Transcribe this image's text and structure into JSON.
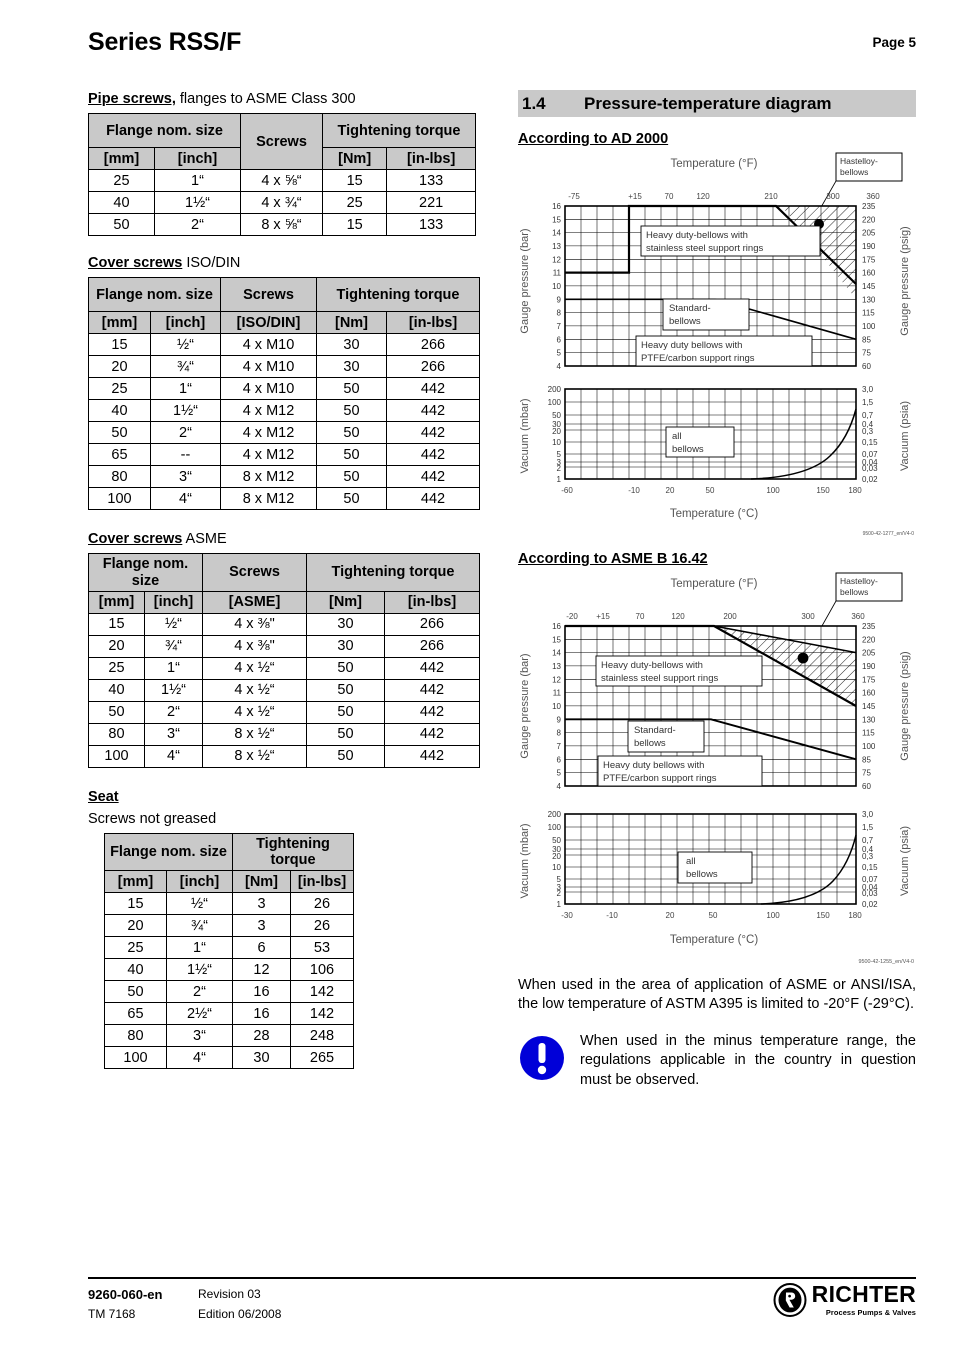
{
  "header": {
    "title": "Series RSS/F",
    "page_label": "Page 5"
  },
  "pipe_screws": {
    "caption_bold": "Pipe screws,",
    "caption_rest": " flanges to ASME Class 300",
    "headers": {
      "flange": "Flange nom. size",
      "screws": "Screws",
      "torque": "Tightening torque",
      "mm": "[mm]",
      "inch": "[inch]",
      "std": "[ASME]",
      "nm": "[Nm]",
      "inlbs": "[in-lbs]"
    },
    "rows": [
      {
        "mm": "25",
        "inch": "1“",
        "screws": "4 x ⅝“",
        "nm": "15",
        "inlbs": "133"
      },
      {
        "mm": "40",
        "inch": "1½“",
        "screws": "4 x ¾“",
        "nm": "25",
        "inlbs": "221"
      },
      {
        "mm": "50",
        "inch": "2“",
        "screws": "8 x ⅝“",
        "nm": "15",
        "inlbs": "133"
      }
    ]
  },
  "cover_screws_iso": {
    "caption_bold": "Cover screws",
    "caption_rest": " ISO/DIN",
    "headers": {
      "flange": "Flange nom. size",
      "screws": "Screws",
      "torque": "Tightening torque",
      "mm": "[mm]",
      "inch": "[inch]",
      "std": "[ISO/DIN]",
      "nm": "[Nm]",
      "inlbs": "[in-lbs]"
    },
    "rows": [
      {
        "mm": "15",
        "inch": "½“",
        "screws": "4 x M10",
        "nm": "30",
        "inlbs": "266"
      },
      {
        "mm": "20",
        "inch": "¾“",
        "screws": "4 x M10",
        "nm": "30",
        "inlbs": "266"
      },
      {
        "mm": "25",
        "inch": "1“",
        "screws": "4 x M10",
        "nm": "50",
        "inlbs": "442"
      },
      {
        "mm": "40",
        "inch": "1½“",
        "screws": "4 x M12",
        "nm": "50",
        "inlbs": "442"
      },
      {
        "mm": "50",
        "inch": "2“",
        "screws": "4 x M12",
        "nm": "50",
        "inlbs": "442"
      },
      {
        "mm": "65",
        "inch": "--",
        "screws": "4 x M12",
        "nm": "50",
        "inlbs": "442"
      },
      {
        "mm": "80",
        "inch": "3“",
        "screws": "8 x M12",
        "nm": "50",
        "inlbs": "442"
      },
      {
        "mm": "100",
        "inch": "4“",
        "screws": "8 x M12",
        "nm": "50",
        "inlbs": "442"
      }
    ]
  },
  "cover_screws_asme": {
    "caption_bold": "Cover screws",
    "caption_rest": " ASME",
    "headers": {
      "flange": "Flange nom. size",
      "screws": "Screws",
      "torque": "Tightening torque",
      "mm": "[mm]",
      "inch": "[inch]",
      "std": "[ASME]",
      "nm": "[Nm]",
      "inlbs": "[in-lbs]"
    },
    "rows": [
      {
        "mm": "15",
        "inch": "½“",
        "screws": "4 x ⅜\"",
        "nm": "30",
        "inlbs": "266"
      },
      {
        "mm": "20",
        "inch": "¾“",
        "screws": "4 x ⅜\"",
        "nm": "30",
        "inlbs": "266"
      },
      {
        "mm": "25",
        "inch": "1“",
        "screws": "4 x ½“",
        "nm": "50",
        "inlbs": "442"
      },
      {
        "mm": "40",
        "inch": "1½“",
        "screws": "4 x ½“",
        "nm": "50",
        "inlbs": "442"
      },
      {
        "mm": "50",
        "inch": "2“",
        "screws": "4 x ½“",
        "nm": "50",
        "inlbs": "442"
      },
      {
        "mm": "80",
        "inch": "3“",
        "screws": "8 x ½“",
        "nm": "50",
        "inlbs": "442"
      },
      {
        "mm": "100",
        "inch": "4“",
        "screws": "8 x ½“",
        "nm": "50",
        "inlbs": "442"
      }
    ]
  },
  "seat": {
    "caption_bold": "Seat",
    "subtitle": "Screws not greased",
    "headers": {
      "flange": "Flange nom. size",
      "torque": "Tightening torque",
      "mm": "[mm]",
      "inch": "[inch]",
      "nm": "[Nm]",
      "inlbs": "[in-lbs]"
    },
    "rows": [
      {
        "mm": "15",
        "inch": "½“",
        "nm": "3",
        "inlbs": "26"
      },
      {
        "mm": "20",
        "inch": "¾“",
        "nm": "3",
        "inlbs": "26"
      },
      {
        "mm": "25",
        "inch": "1“",
        "nm": "6",
        "inlbs": "53"
      },
      {
        "mm": "40",
        "inch": "1½“",
        "nm": "12",
        "inlbs": "106"
      },
      {
        "mm": "50",
        "inch": "2“",
        "nm": "16",
        "inlbs": "142"
      },
      {
        "mm": "65",
        "inch": "2½“",
        "nm": "16",
        "inlbs": "142"
      },
      {
        "mm": "80",
        "inch": "3“",
        "nm": "28",
        "inlbs": "248"
      },
      {
        "mm": "100",
        "inch": "4“",
        "nm": "30",
        "inlbs": "265"
      }
    ]
  },
  "section": {
    "number": "1.4",
    "title": "Pressure-temperature diagram"
  },
  "diagram_ad2000": {
    "heading": "According to AD 2000",
    "drawing_no": "9500-42-1277_en/V4-0"
  },
  "diagram_asme": {
    "heading": "According to ASME B 16.42",
    "drawing_no": "9500-42-1255_en/V4-0"
  },
  "chart_data": [
    {
      "type": "line",
      "id": "ad2000-pressure",
      "title": "",
      "xlabel": "Temperature (°F)",
      "ylabel": "Gauge pressure (bar)",
      "ylabel_right": "Gauge pressure (psig)",
      "xticks": [
        "-75",
        "+15",
        "70",
        "120",
        "210",
        "300",
        "360"
      ],
      "xtick_values": [
        -75,
        15,
        70,
        120,
        210,
        300,
        360
      ],
      "yticks": [
        "16",
        "15",
        "14",
        "13",
        "12",
        "11",
        "10",
        "9",
        "8",
        "7",
        "6",
        "5",
        "4"
      ],
      "yticks_right": [
        "235",
        "220",
        "205",
        "190",
        "175",
        "160",
        "145",
        "130",
        "115",
        "100",
        "85",
        "75",
        "60"
      ],
      "ylim": [
        4,
        16
      ],
      "grid": true,
      "annotations": [
        "Heavy duty-bellows with stainless steel support rings",
        "Standard-bellows",
        "Heavy duty bellows with PTFE/carbon support rings",
        "Hastelloy-bellows"
      ],
      "series": [
        {
          "name": "heavy-duty-stainless-limit",
          "points": [
            [
              -75,
              12
            ],
            [
              15,
              12
            ],
            [
              15,
              16
            ],
            [
              250,
              16
            ],
            [
              360,
              10.4
            ]
          ]
        },
        {
          "name": "standard-bellows-limit",
          "points": [
            [
              -75,
              10
            ],
            [
              185,
              10
            ],
            [
              360,
              7
            ]
          ]
        }
      ],
      "markers": [
        {
          "name": "hastelloy-operating-point",
          "x": 318,
          "y": 14.6
        }
      ],
      "hatched_region": "upper-right wedge between 16 bar line and heavy-duty limit"
    },
    {
      "type": "line",
      "id": "ad2000-vacuum",
      "xlabel": "Temperature (°C)",
      "ylabel": "Vacuum (mbar)",
      "ylabel_right": "Vacuum (psia)",
      "xticks": [
        "-60",
        "-10",
        "20",
        "50",
        "100",
        "150",
        "180"
      ],
      "xtick_values": [
        -60,
        -10,
        20,
        50,
        100,
        150,
        180
      ],
      "yticks": [
        "200",
        "100",
        "50",
        "30",
        "20",
        "10",
        "5",
        "3",
        "2",
        "1"
      ],
      "yticks_right": [
        "3,0",
        "1,5",
        "0,7",
        "0,4",
        "0,3",
        "0,15",
        "0,07",
        "0,04",
        "0,03",
        "0,02"
      ],
      "scale": "log",
      "grid": true,
      "annotations": [
        "all bellows"
      ],
      "series": [
        {
          "name": "all-bellows-limit",
          "points": [
            [
              118,
              1
            ],
            [
              140,
              1.5
            ],
            [
              160,
              3
            ],
            [
              172,
              6
            ],
            [
              180,
              12
            ]
          ]
        }
      ]
    },
    {
      "type": "line",
      "id": "asme-pressure",
      "xlabel": "Temperature (°F)",
      "ylabel": "Gauge pressure (bar)",
      "ylabel_right": "Gauge pressure (psig)",
      "xticks": [
        "-20",
        "+15",
        "70",
        "120",
        "200",
        "300",
        "360"
      ],
      "xtick_values": [
        -20,
        15,
        70,
        120,
        200,
        300,
        360
      ],
      "yticks": [
        "16",
        "15",
        "14",
        "13",
        "12",
        "11",
        "10",
        "9",
        "8",
        "7",
        "6",
        "5",
        "4"
      ],
      "yticks_right": [
        "235",
        "220",
        "205",
        "190",
        "175",
        "160",
        "145",
        "130",
        "115",
        "100",
        "85",
        "75",
        "60"
      ],
      "ylim": [
        4,
        16
      ],
      "grid": true,
      "annotations": [
        "Heavy duty-bellows with stainless steel support rings",
        "Standard-bellows",
        "Heavy duty bellows with PTFE/carbon support rings",
        "Hastelloy-bellows"
      ],
      "series": [
        {
          "name": "heavy-duty-stainless-limit",
          "points": [
            [
              -20,
              16
            ],
            [
              200,
              16
            ],
            [
              360,
              10
            ]
          ]
        },
        {
          "name": "hastelloy-upper-limit",
          "points": [
            [
              200,
              16
            ],
            [
              360,
              14
            ]
          ]
        },
        {
          "name": "standard-bellows-limit",
          "points": [
            [
              -20,
              10
            ],
            [
              195,
              10
            ],
            [
              360,
              7
            ]
          ]
        }
      ],
      "markers": [
        {
          "name": "hastelloy-operating-point",
          "x": 305,
          "y": 13.6
        }
      ],
      "hatched_region": "wedge between hastelloy upper limit and heavy duty limit"
    },
    {
      "type": "line",
      "id": "asme-vacuum",
      "xlabel": "Temperature (°C)",
      "ylabel": "Vacuum (mbar)",
      "ylabel_right": "Vacuum (psia)",
      "xticks": [
        "-30",
        "-10",
        "20",
        "50",
        "100",
        "150",
        "180"
      ],
      "xtick_values": [
        -30,
        -10,
        20,
        50,
        100,
        150,
        180
      ],
      "yticks": [
        "200",
        "100",
        "50",
        "30",
        "20",
        "10",
        "5",
        "3",
        "2",
        "1"
      ],
      "yticks_right": [
        "3,0",
        "1,5",
        "0,7",
        "0,4",
        "0,3",
        "0,15",
        "0,07",
        "0,04",
        "0,03",
        "0,02"
      ],
      "scale": "log",
      "grid": true,
      "annotations": [
        "all bellows"
      ],
      "series": [
        {
          "name": "all-bellows-limit",
          "points": [
            [
              118,
              1
            ],
            [
              140,
              1.6
            ],
            [
              160,
              3.2
            ],
            [
              172,
              6
            ],
            [
              180,
              12
            ]
          ]
        }
      ]
    }
  ],
  "notes": {
    "paragraph": "When used in the area of application of ASME or ANSI/ISA, the low temperature of ASTM A395 is limited to -20°F (-29°C).",
    "warning": "When used in the minus temperature range, the regulations applicable in the country in question must be observed.",
    "warning_color": "#0000d8"
  },
  "footer": {
    "doc_no": "9260-060-en",
    "tm_no": "TM 7168",
    "revision": "Revision 03",
    "edition": "Edition 06/2008",
    "logo_word": "RICHTER",
    "logo_tagline": "Process Pumps & Valves"
  }
}
